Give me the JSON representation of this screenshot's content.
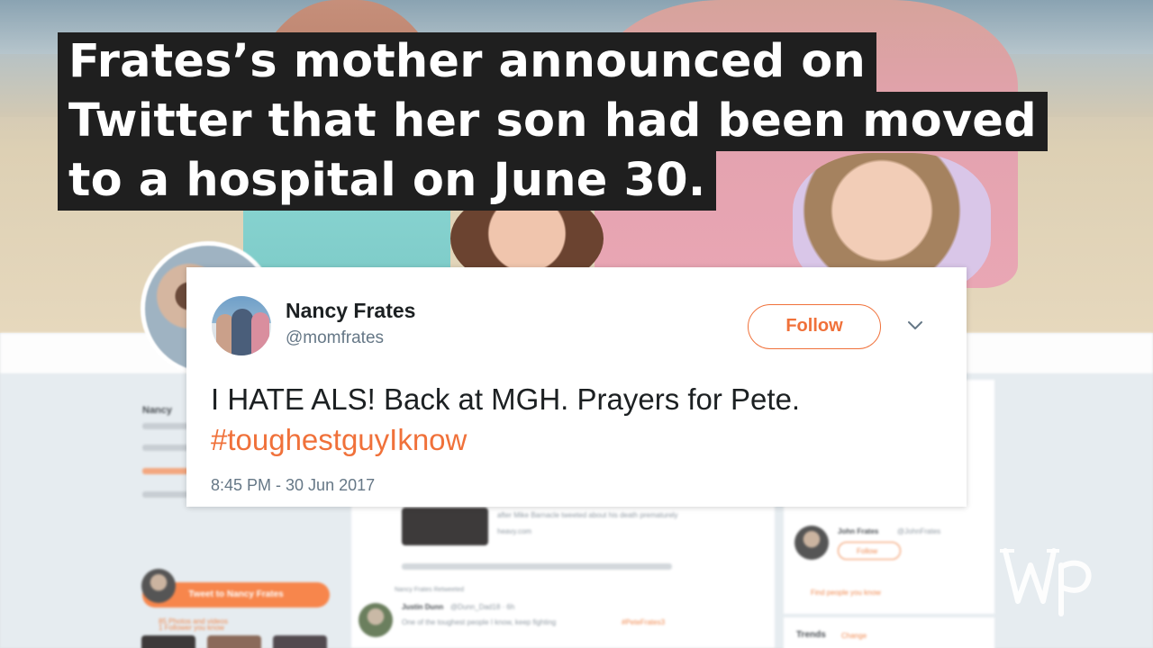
{
  "caption": {
    "lines": [
      "Frates’s mother announced on",
      "Twitter that her son had been moved",
      "to a hospital on June 30."
    ]
  },
  "tweet": {
    "author_name": "Nancy Frates",
    "author_handle": "@momfrates",
    "follow_label": "Follow",
    "text": "I HATE ALS! Back at MGH. Prayers for Pete.",
    "hashtag": "#toughestguyIknow",
    "timestamp": "8:45 PM - 30 Jun 2017",
    "accent_color": "#f0713a"
  },
  "background_profile": {
    "profile_name": "Nancy",
    "tweet_to_label": "Tweet to Nancy Frates",
    "followers_you_know": "1 Follower you know",
    "photos_videos": "85 Photos and videos",
    "feed_link_text": "after Mike Barnacle tweeted about his death prematurely",
    "feed_domain": "heavy.com",
    "liked_by": "Nancy Frates Retweeted",
    "reply_author": "Justin Dunn",
    "reply_handle": "@Dunn_Dad18 · 6h",
    "reply_text": "One of the toughest people I know, keep fighting",
    "reply_hashtag": "#PeteFrates3",
    "suggested_name": "John Frates",
    "suggested_handle": "@JohnFrates",
    "suggested_follow": "Follow",
    "find_people": "Find people you know",
    "trends_label": "Trends",
    "trends_change": "Change"
  },
  "watermark": {
    "brand": "The Washington Post",
    "icon": "wp-logo-icon"
  }
}
